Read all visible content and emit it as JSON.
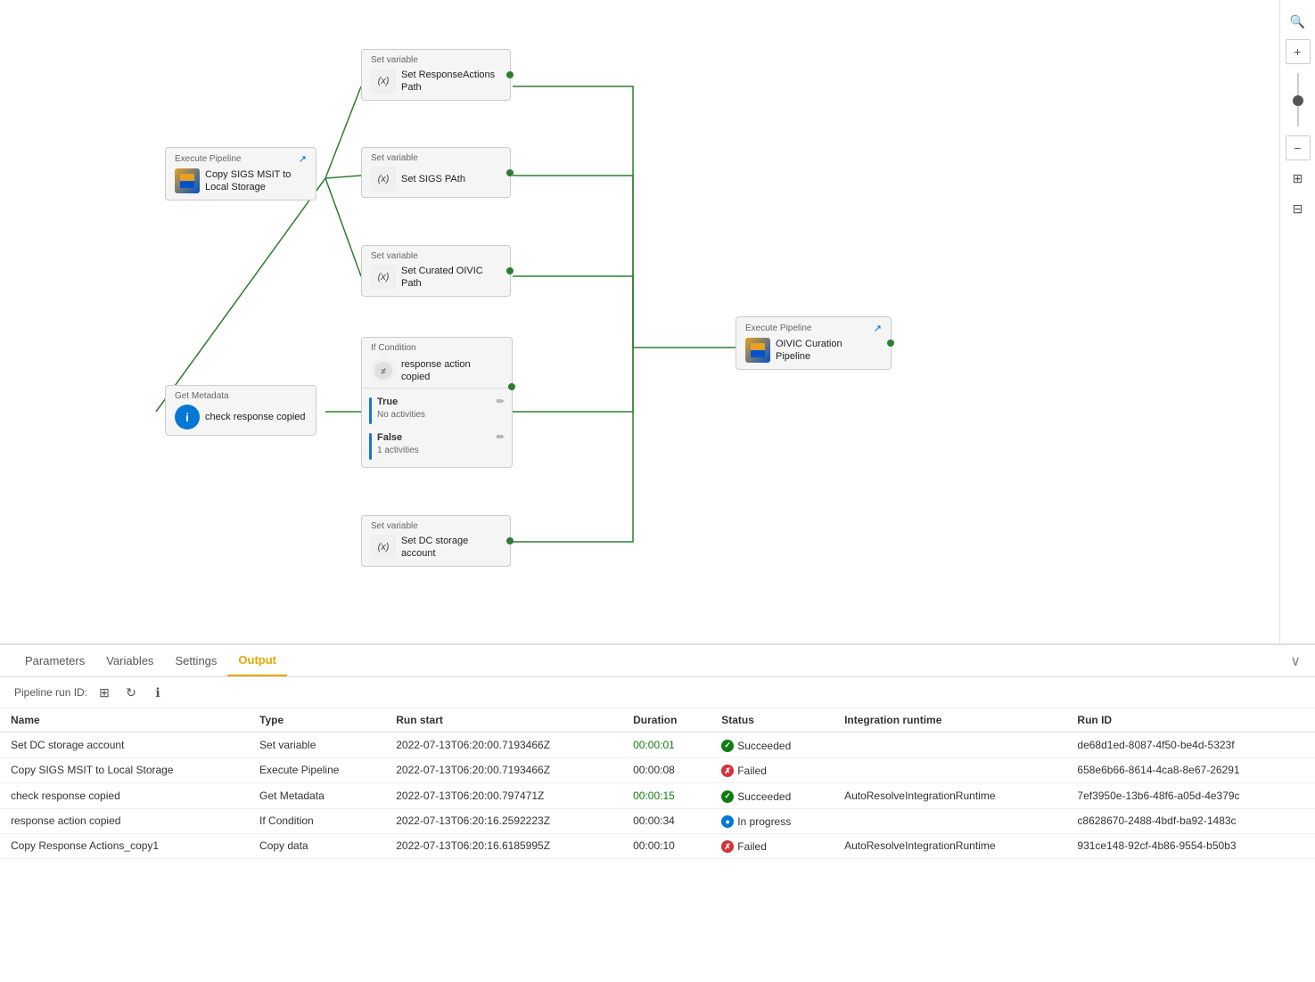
{
  "tabs": [
    {
      "label": "Parameters",
      "active": false
    },
    {
      "label": "Variables",
      "active": false
    },
    {
      "label": "Settings",
      "active": false
    },
    {
      "label": "Output",
      "active": true
    }
  ],
  "pipeline_run_id_label": "Pipeline run ID:",
  "table": {
    "columns": [
      "Name",
      "Type",
      "Run start",
      "Duration",
      "Status",
      "Integration runtime",
      "Run ID"
    ],
    "rows": [
      {
        "name": "Set DC storage account",
        "type": "Set variable",
        "run_start": "2022-07-13T06:20:00.7193466Z",
        "duration": "00:00:01",
        "status": "Succeeded",
        "status_type": "succeeded",
        "integration_runtime": "",
        "run_id": "de68d1ed-8087-4f50-be4d-5323f"
      },
      {
        "name": "Copy SIGS MSIT to Local Storage",
        "type": "Execute Pipeline",
        "run_start": "2022-07-13T06:20:00.7193466Z",
        "duration": "00:00:08",
        "status": "Failed",
        "status_type": "failed",
        "integration_runtime": "",
        "run_id": "658e6b66-8614-4ca8-8e67-26291"
      },
      {
        "name": "check response copied",
        "type": "Get Metadata",
        "run_start": "2022-07-13T06:20:00.797471Z",
        "duration": "00:00:15",
        "status": "Succeeded",
        "status_type": "succeeded",
        "integration_runtime": "AutoResolveIntegrationRuntime",
        "run_id": "7ef3950e-13b6-48f6-a05d-4e379c"
      },
      {
        "name": "response action copied",
        "type": "If Condition",
        "run_start": "2022-07-13T06:20:16.2592223Z",
        "duration": "00:00:34",
        "status": "In progress",
        "status_type": "in-progress",
        "integration_runtime": "",
        "run_id": "c8628670-2488-4bdf-ba92-1483c"
      },
      {
        "name": "Copy Response Actions_copy1",
        "type": "Copy data",
        "run_start": "2022-07-13T06:20:16.6185995Z",
        "duration": "00:00:10",
        "status": "Failed",
        "status_type": "failed",
        "integration_runtime": "AutoResolveIntegrationRuntime",
        "run_id": "931ce148-92cf-4b86-9554-b50b3"
      }
    ]
  },
  "nodes": {
    "execute_pipeline_1": {
      "header": "Execute Pipeline",
      "label": "Copy SIGS MSIT to\nLocal Storage"
    },
    "set_var_1": {
      "header": "Set variable",
      "label": "Set ResponseActions\nPath"
    },
    "set_var_2": {
      "header": "Set variable",
      "label": "Set SIGS PAth"
    },
    "set_var_3": {
      "header": "Set variable",
      "label": "Set Curated OIVIC\nPath"
    },
    "set_var_4": {
      "header": "Set variable",
      "label": "Set DC storage\naccount"
    },
    "get_metadata": {
      "header": "Get Metadata",
      "label": "check response copied"
    },
    "if_condition": {
      "header": "If Condition",
      "label": "response action\ncopied",
      "true_label": "True",
      "true_sub": "No activities",
      "false_label": "False",
      "false_sub": "1 activities"
    },
    "execute_pipeline_2": {
      "header": "Execute Pipeline",
      "label": "OIVIC Curation\nPipeline"
    }
  }
}
